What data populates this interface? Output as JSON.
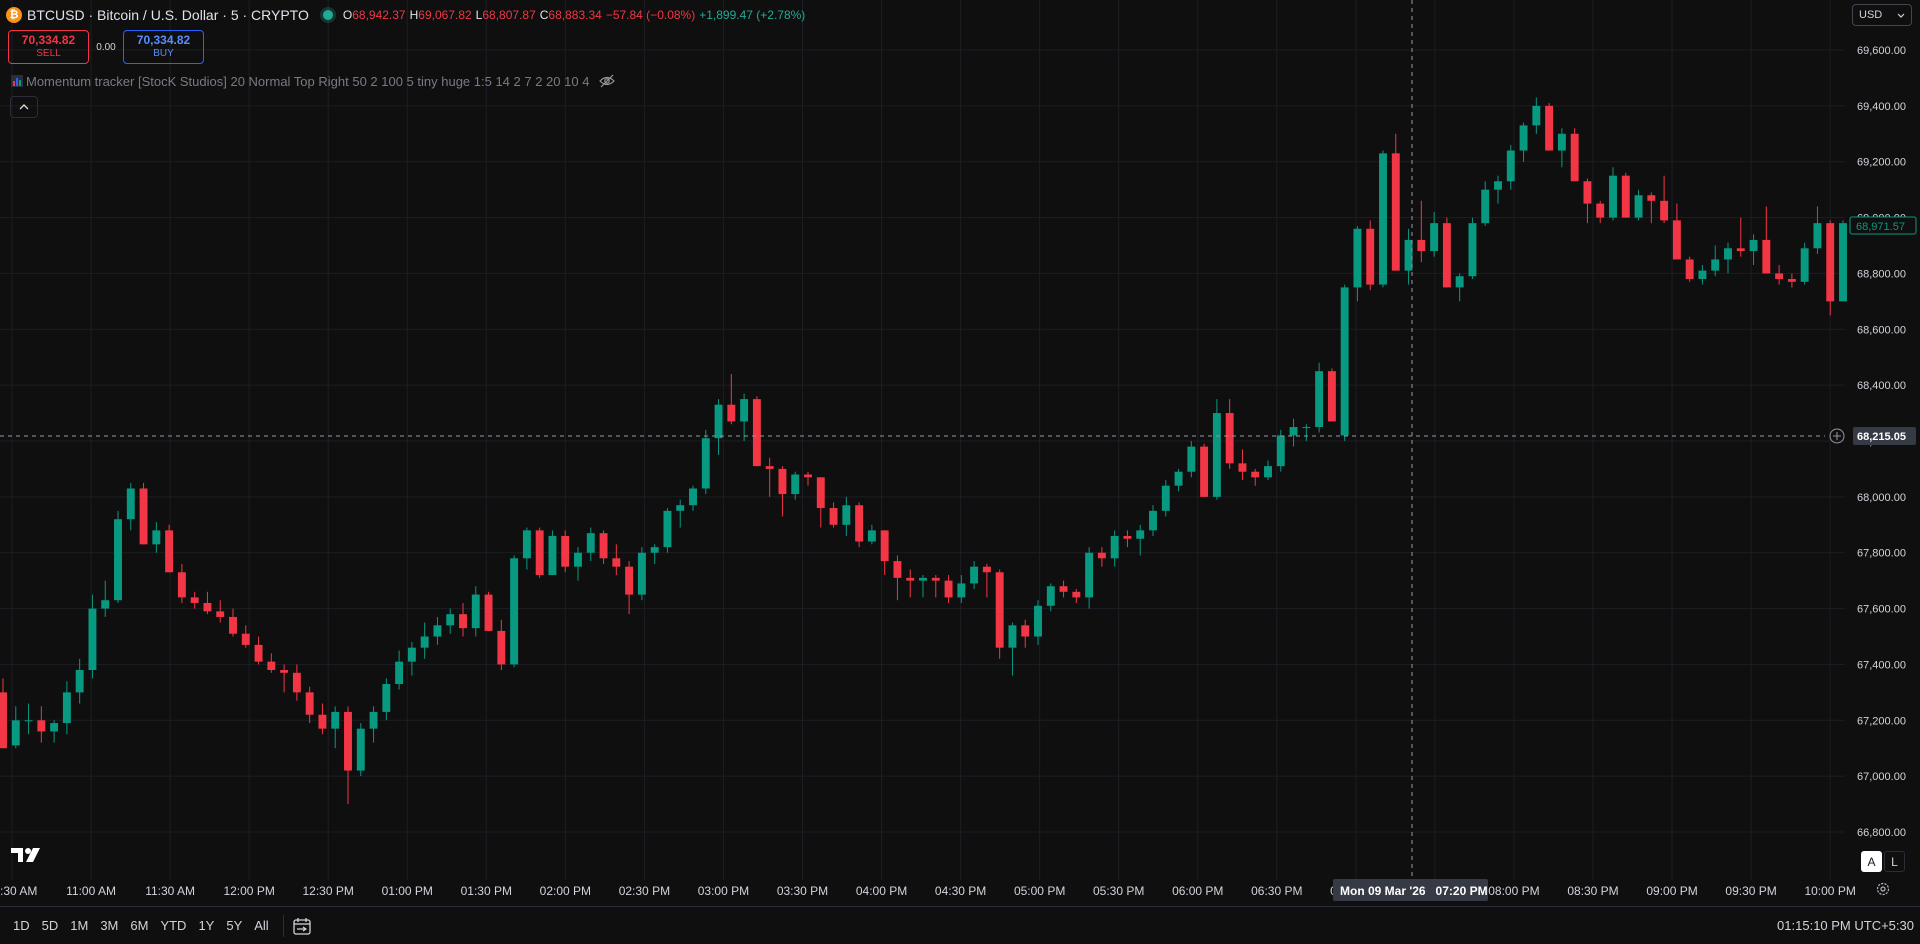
{
  "header": {
    "symbol": "BTCUSD · Bitcoin / U.S. Dollar · 5 · CRYPTO",
    "logo_letter": "₿",
    "ohlc": {
      "o_label": "O",
      "o": "68,942.37",
      "h_label": "H",
      "h": "69,067.82",
      "l_label": "L",
      "l": "68,807.87",
      "c_label": "C",
      "c": "68,883.34",
      "change": "−57.84 (−0.08%)",
      "day_change": "+1,899.47 (+2.78%)"
    },
    "status_color": "#22ab94"
  },
  "trade": {
    "sell_price": "70,334.82",
    "sell_label": "SELL",
    "spread": "0.00",
    "buy_price": "70,334.82",
    "buy_label": "BUY"
  },
  "indicator": {
    "text": "Momentum tracker [StocK Studios] 20 Normal Top Right 50 2 100 5 tiny huge 1:5 14 2 7 2 20 10 4",
    "icon": "bar-chart-icon",
    "visibility_icon": "eye-off-icon"
  },
  "currency": "USD",
  "price_axis": {
    "ticks": [
      "69,600.00",
      "69,400.00",
      "69,200.00",
      "69,000.00",
      "68,800.00",
      "68,600.00",
      "68,400.00",
      "68,200.00",
      "68,000.00",
      "67,800.00",
      "67,600.00",
      "67,400.00",
      "67,200.00",
      "67,000.00",
      "66,800.00"
    ],
    "current_price": "68,971.57",
    "crosshair_price": "68,215.05"
  },
  "time_axis": {
    "ticks": [
      "10:30 AM",
      "11:00 AM",
      "11:30 AM",
      "12:00 PM",
      "12:30 PM",
      "01:00 PM",
      "01:30 PM",
      "02:00 PM",
      "02:30 PM",
      "03:00 PM",
      "03:30 PM",
      "04:00 PM",
      "04:30 PM",
      "05:00 PM",
      "05:30 PM",
      "06:00 PM",
      "06:30 PM",
      "07:00 PM",
      "07:30 PM",
      "08:00 PM",
      "08:30 PM",
      "09:00 PM",
      "09:30 PM",
      "10:00 PM"
    ],
    "crosshair_label": "Mon 09 Mar '26   07:20 PM"
  },
  "colors": {
    "up": "#089981",
    "down": "#f23645",
    "background": "#0f0f0f",
    "grid": "#1c1e24"
  },
  "bottom": {
    "ranges": [
      "1D",
      "5D",
      "1M",
      "3M",
      "6M",
      "YTD",
      "1Y",
      "5Y",
      "All"
    ],
    "clock": "01:15:10 PM UTC+5:30"
  },
  "scale_buttons": {
    "auto": "A",
    "log": "L"
  },
  "chart_data": {
    "type": "candlestick",
    "interval": "5",
    "yrange": [
      66700,
      69700
    ],
    "ohlc": [
      [
        67300,
        67350,
        67100,
        67100
      ],
      [
        67110,
        67250,
        67100,
        67200
      ],
      [
        67200,
        67260,
        67150,
        67200
      ],
      [
        67200,
        67250,
        67120,
        67160
      ],
      [
        67160,
        67200,
        67120,
        67190
      ],
      [
        67190,
        67340,
        67150,
        67300
      ],
      [
        67300,
        67420,
        67260,
        67380
      ],
      [
        67380,
        67650,
        67350,
        67600
      ],
      [
        67600,
        67700,
        67570,
        67630
      ],
      [
        67630,
        67950,
        67620,
        67920
      ],
      [
        67920,
        68050,
        67880,
        68030
      ],
      [
        68030,
        68050,
        67830,
        67830
      ],
      [
        67830,
        67910,
        67800,
        67880
      ],
      [
        67880,
        67900,
        67730,
        67730
      ],
      [
        67730,
        67760,
        67620,
        67640
      ],
      [
        67640,
        67660,
        67600,
        67620
      ],
      [
        67620,
        67660,
        67580,
        67590
      ],
      [
        67590,
        67630,
        67550,
        67570
      ],
      [
        67570,
        67600,
        67500,
        67510
      ],
      [
        67510,
        67540,
        67460,
        67470
      ],
      [
        67470,
        67500,
        67400,
        67410
      ],
      [
        67410,
        67440,
        67370,
        67380
      ],
      [
        67380,
        67400,
        67300,
        67370
      ],
      [
        67370,
        67400,
        67270,
        67300
      ],
      [
        67300,
        67320,
        67190,
        67220
      ],
      [
        67220,
        67260,
        67150,
        67170
      ],
      [
        67170,
        67250,
        67100,
        67230
      ],
      [
        67230,
        67250,
        66900,
        67020
      ],
      [
        67020,
        67190,
        67000,
        67170
      ],
      [
        67170,
        67250,
        67120,
        67230
      ],
      [
        67230,
        67350,
        67200,
        67330
      ],
      [
        67330,
        67450,
        67310,
        67410
      ],
      [
        67410,
        67480,
        67360,
        67460
      ],
      [
        67460,
        67550,
        67420,
        67500
      ],
      [
        67500,
        67570,
        67470,
        67540
      ],
      [
        67540,
        67600,
        67510,
        67580
      ],
      [
        67580,
        67620,
        67500,
        67530
      ],
      [
        67530,
        67680,
        67500,
        67650
      ],
      [
        67650,
        67660,
        67520,
        67520
      ],
      [
        67520,
        67560,
        67380,
        67400
      ],
      [
        67400,
        67790,
        67390,
        67780
      ],
      [
        67780,
        67890,
        67740,
        67880
      ],
      [
        67880,
        67890,
        67710,
        67720
      ],
      [
        67720,
        67880,
        67720,
        67860
      ],
      [
        67860,
        67880,
        67730,
        67750
      ],
      [
        67750,
        67820,
        67700,
        67800
      ],
      [
        67800,
        67890,
        67770,
        67870
      ],
      [
        67870,
        67880,
        67760,
        67780
      ],
      [
        67780,
        67830,
        67720,
        67750
      ],
      [
        67750,
        67770,
        67580,
        67650
      ],
      [
        67650,
        67820,
        67630,
        67800
      ],
      [
        67800,
        67830,
        67760,
        67820
      ],
      [
        67820,
        67960,
        67800,
        67950
      ],
      [
        67950,
        67990,
        67890,
        67970
      ],
      [
        67970,
        68040,
        67950,
        68030
      ],
      [
        68030,
        68240,
        68010,
        68210
      ],
      [
        68210,
        68350,
        68150,
        68330
      ],
      [
        68330,
        68440,
        68260,
        68270
      ],
      [
        68270,
        68370,
        68200,
        68350
      ],
      [
        68350,
        68360,
        68110,
        68110
      ],
      [
        68110,
        68140,
        68000,
        68100
      ],
      [
        68100,
        68110,
        67930,
        68010
      ],
      [
        68010,
        68090,
        67990,
        68080
      ],
      [
        68080,
        68090,
        68040,
        68070
      ],
      [
        68070,
        68070,
        67890,
        67960
      ],
      [
        67960,
        67980,
        67890,
        67900
      ],
      [
        67900,
        68000,
        67860,
        67970
      ],
      [
        67970,
        67980,
        67820,
        67840
      ],
      [
        67840,
        67900,
        67830,
        67880
      ],
      [
        67880,
        67880,
        67720,
        67770
      ],
      [
        67770,
        67790,
        67630,
        67710
      ],
      [
        67710,
        67740,
        67640,
        67700
      ],
      [
        67700,
        67720,
        67640,
        67710
      ],
      [
        67710,
        67720,
        67640,
        67700
      ],
      [
        67700,
        67720,
        67620,
        67640
      ],
      [
        67640,
        67720,
        67620,
        67690
      ],
      [
        67690,
        67770,
        67670,
        67750
      ],
      [
        67750,
        67760,
        67640,
        67730
      ],
      [
        67730,
        67740,
        67420,
        67460
      ],
      [
        67460,
        67550,
        67360,
        67540
      ],
      [
        67540,
        67560,
        67460,
        67500
      ],
      [
        67500,
        67630,
        67470,
        67610
      ],
      [
        67610,
        67690,
        67590,
        67680
      ],
      [
        67680,
        67700,
        67640,
        67660
      ],
      [
        67660,
        67670,
        67620,
        67640
      ],
      [
        67640,
        67820,
        67600,
        67800
      ],
      [
        67800,
        67820,
        67750,
        67780
      ],
      [
        67780,
        67880,
        67750,
        67860
      ],
      [
        67860,
        67880,
        67820,
        67850
      ],
      [
        67850,
        67900,
        67790,
        67880
      ],
      [
        67880,
        67970,
        67860,
        67950
      ],
      [
        67950,
        68060,
        67930,
        68040
      ],
      [
        68040,
        68100,
        68020,
        68090
      ],
      [
        68090,
        68200,
        68070,
        68180
      ],
      [
        68180,
        68190,
        68000,
        68000
      ],
      [
        68000,
        68350,
        67990,
        68300
      ],
      [
        68300,
        68350,
        68100,
        68120
      ],
      [
        68120,
        68170,
        68060,
        68090
      ],
      [
        68090,
        68100,
        68040,
        68070
      ],
      [
        68070,
        68130,
        68060,
        68110
      ],
      [
        68110,
        68240,
        68090,
        68220
      ],
      [
        68220,
        68280,
        68180,
        68250
      ],
      [
        68250,
        68260,
        68200,
        68250
      ],
      [
        68250,
        68480,
        68230,
        68450
      ],
      [
        68450,
        68460,
        68270,
        68270
      ],
      [
        68220,
        68760,
        68200,
        68750
      ],
      [
        68750,
        68970,
        68700,
        68960
      ],
      [
        68960,
        68990,
        68740,
        68760
      ],
      [
        68760,
        69240,
        68750,
        69230
      ],
      [
        69230,
        69300,
        68810,
        68810
      ],
      [
        68810,
        68960,
        68760,
        68920
      ],
      [
        68920,
        69060,
        68840,
        68880
      ],
      [
        68880,
        69020,
        68860,
        68980
      ],
      [
        68980,
        69000,
        68750,
        68750
      ],
      [
        68750,
        68800,
        68700,
        68790
      ],
      [
        68790,
        69000,
        68780,
        68980
      ],
      [
        68980,
        69130,
        68970,
        69100
      ],
      [
        69100,
        69150,
        69050,
        69130
      ],
      [
        69130,
        69260,
        69100,
        69240
      ],
      [
        69240,
        69340,
        69200,
        69330
      ],
      [
        69330,
        69430,
        69300,
        69400
      ],
      [
        69400,
        69410,
        69240,
        69240
      ],
      [
        69240,
        69320,
        69180,
        69300
      ],
      [
        69300,
        69320,
        69130,
        69130
      ],
      [
        69130,
        69140,
        68980,
        69050
      ],
      [
        69050,
        69060,
        68980,
        69000
      ],
      [
        69000,
        69180,
        68990,
        69150
      ],
      [
        69150,
        69160,
        69000,
        69000
      ],
      [
        69000,
        69100,
        68990,
        69080
      ],
      [
        69080,
        69090,
        68980,
        69060
      ],
      [
        69060,
        69150,
        68980,
        68990
      ],
      [
        68990,
        69050,
        68850,
        68850
      ],
      [
        68850,
        68860,
        68770,
        68780
      ],
      [
        68780,
        68830,
        68760,
        68810
      ],
      [
        68810,
        68900,
        68790,
        68850
      ],
      [
        68850,
        68910,
        68800,
        68890
      ],
      [
        68890,
        69000,
        68860,
        68880
      ],
      [
        68880,
        68940,
        68830,
        68920
      ],
      [
        68920,
        69040,
        68800,
        68800
      ],
      [
        68800,
        68830,
        68760,
        68780
      ],
      [
        68780,
        68800,
        68750,
        68770
      ],
      [
        68770,
        68910,
        68760,
        68890
      ],
      [
        68890,
        69040,
        68870,
        68980
      ],
      [
        68980,
        68990,
        68650,
        68700
      ],
      [
        68700,
        68990,
        68700,
        68980
      ]
    ]
  }
}
